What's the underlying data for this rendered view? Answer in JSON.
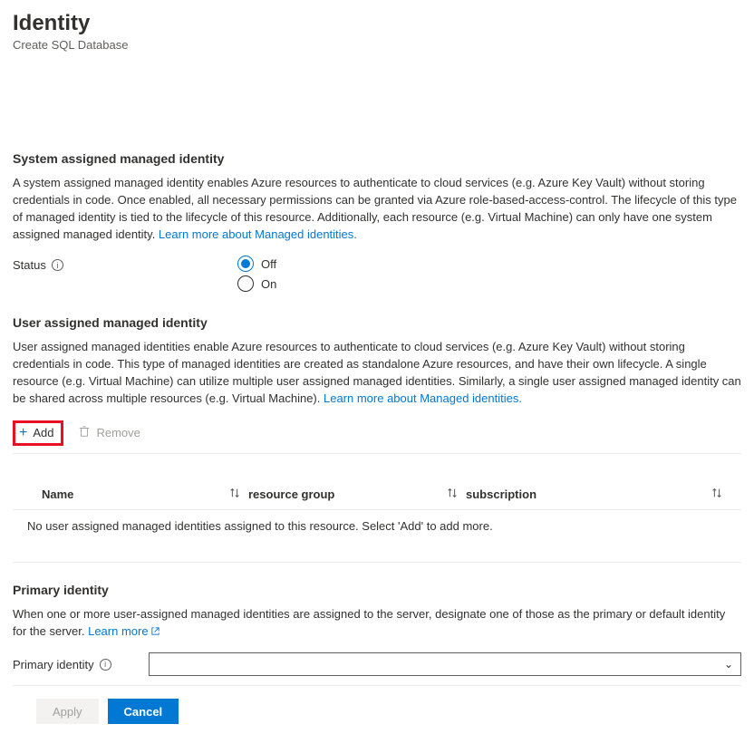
{
  "header": {
    "title": "Identity",
    "subtitle": "Create SQL Database"
  },
  "system": {
    "heading": "System assigned managed identity",
    "desc": "A system assigned managed identity enables Azure resources to authenticate to cloud services (e.g. Azure Key Vault) without storing credentials in code. Once enabled, all necessary permissions can be granted via Azure role-based-access-control. The lifecycle of this type of managed identity is tied to the lifecycle of this resource. Additionally, each resource (e.g. Virtual Machine) can only have one system assigned managed identity. ",
    "learn_link": "Learn more about Managed identities.",
    "status_label": "Status",
    "opt_off": "Off",
    "opt_on": "On"
  },
  "user": {
    "heading": "User assigned managed identity",
    "desc": "User assigned managed identities enable Azure resources to authenticate to cloud services (e.g. Azure Key Vault) without storing credentials in code. This type of managed identities are created as standalone Azure resources, and have their own lifecycle. A single resource (e.g. Virtual Machine) can utilize multiple user assigned managed identities. Similarly, a single user assigned managed identity can be shared across multiple resources (e.g. Virtual Machine). ",
    "learn_link": "Learn more about Managed identities.",
    "add_label": "Add",
    "remove_label": "Remove",
    "col_name": "Name",
    "col_rg": "resource group",
    "col_sub": "subscription",
    "empty_msg": "No user assigned managed identities assigned to this resource. Select 'Add' to add more."
  },
  "primary": {
    "heading": "Primary identity",
    "desc": "When one or more user-assigned managed identities are assigned to the server, designate one of those as the primary or default identity for the server. ",
    "learn_link": "Learn more",
    "field_label": "Primary identity"
  },
  "actions": {
    "apply": "Apply",
    "cancel": "Cancel"
  }
}
